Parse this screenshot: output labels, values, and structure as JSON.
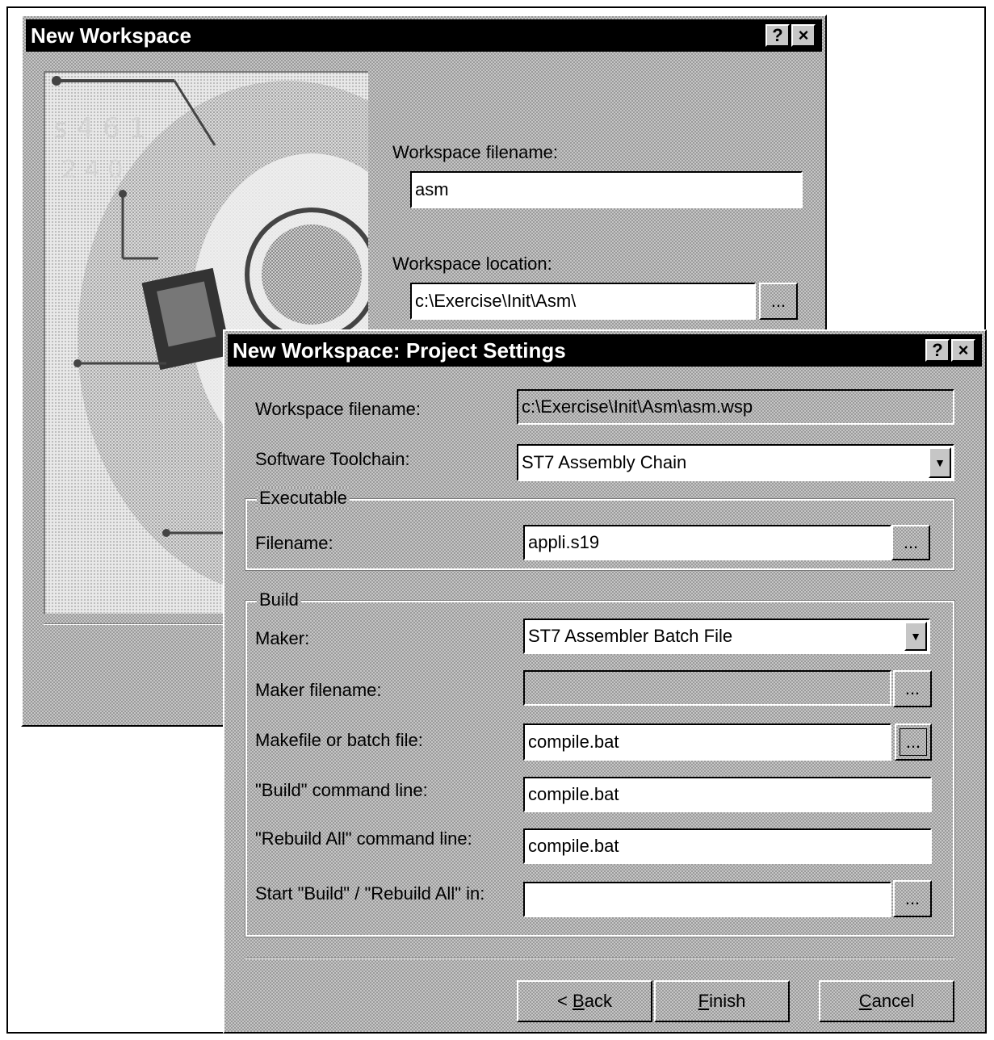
{
  "back_window": {
    "title": "New Workspace",
    "help_glyph": "?",
    "close_glyph": "×",
    "filename_label": "Workspace filename:",
    "filename_value": "asm",
    "location_label": "Workspace location:",
    "location_value": "c:\\Exercise\\Init\\Asm\\",
    "browse_label": "..."
  },
  "front_window": {
    "title": "New Workspace: Project Settings",
    "help_glyph": "?",
    "close_glyph": "×",
    "workspace_filename_label": "Workspace filename:",
    "workspace_filename_value": "c:\\Exercise\\Init\\Asm\\asm.wsp",
    "toolchain_label": "Software Toolchain:",
    "toolchain_value": "ST7 Assembly Chain",
    "executable_group": "Executable",
    "exe_filename_label": "Filename:",
    "exe_filename_value": "appli.s19",
    "build_group": "Build",
    "maker_label": "Maker:",
    "maker_value": "ST7 Assembler Batch File",
    "maker_filename_label": "Maker filename:",
    "maker_filename_value": "",
    "makefile_label": "Makefile or batch file:",
    "makefile_value": "compile.bat",
    "build_cmd_label": "\"Build\" command line:",
    "build_cmd_value": "compile.bat",
    "rebuild_cmd_label": "\"Rebuild All\" command line:",
    "rebuild_cmd_value": "compile.bat",
    "start_in_label": "Start \"Build\" / \"Rebuild All\" in:",
    "start_in_value": "",
    "browse_label": "...",
    "dropdown_glyph": "▼",
    "back_button": {
      "prefix": "< ",
      "accel": "B",
      "rest": "ack"
    },
    "finish_button": {
      "prefix": "",
      "accel": "F",
      "rest": "inish"
    },
    "cancel_button": {
      "prefix": "",
      "accel": "C",
      "rest": "ancel"
    }
  }
}
